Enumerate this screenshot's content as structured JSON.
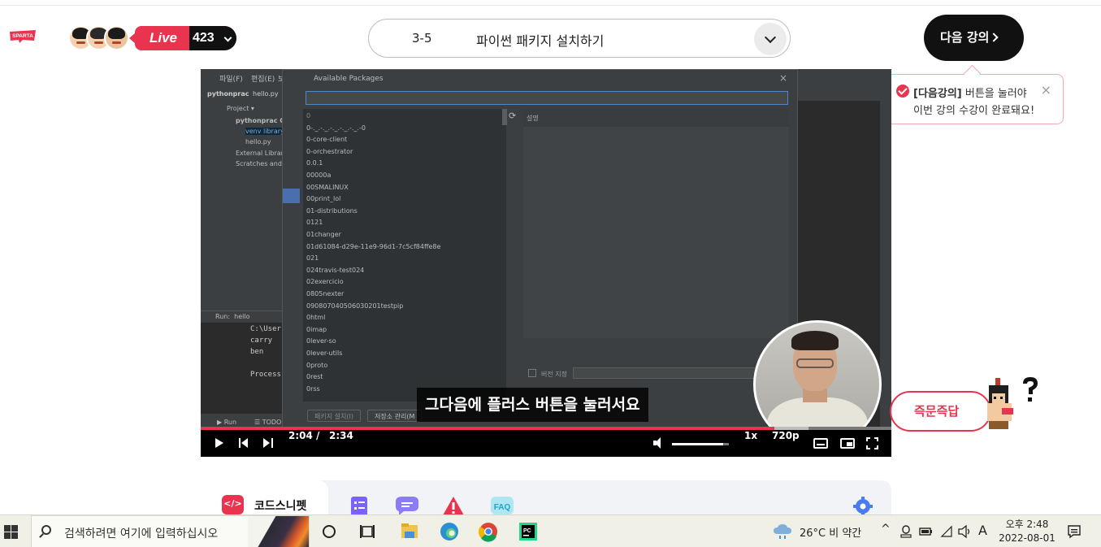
{
  "header": {
    "logo_text": "SPARTA",
    "live_label": "Live",
    "viewer_count": "423",
    "lecture_number": "3-5",
    "lecture_title": "파이썬 패키지 설치하기",
    "next_button_label": "다음 강의",
    "tooltip": {
      "bold_text": "[다음강의]",
      "line1_rest": " 버튼을 눌러야",
      "line2": "이번 강의 수강이 완료돼요!",
      "close": "×"
    }
  },
  "video": {
    "ide": {
      "menu": [
        "파일(F)",
        "편집(E)",
        "보"
      ],
      "project_name": "pythonprac",
      "open_file": "hello.py",
      "tree": [
        "Project ▾",
        "pythonprac C:",
        "venv library",
        "hello.py",
        "External Librarie",
        "Scratches and C"
      ],
      "run_tab": "hello",
      "run_label": "Run:",
      "run_output": [
        "C:\\User",
        "carry",
        "ben",
        "",
        "Process"
      ],
      "bottom_tabs": [
        "▶ Run",
        "☰ TODO"
      ]
    },
    "dialog": {
      "title": "Available Packages",
      "close": "×",
      "packages": [
        "0",
        "0-._.-._.-._.-._.-._.-0",
        "0-core-client",
        "0-orchestrator",
        "0.0.1",
        "00000a",
        "00SMALINUX",
        "00print_lol",
        "01-distributions",
        "0121",
        "01changer",
        "01d61084-d29e-11e9-96d1-7c5cf84ffe8e",
        "021",
        "024travis-test024",
        "02exercicio",
        "0805nexter",
        "090807040506030201testpip",
        "0html",
        "0imap",
        "0lever-so",
        "0lever-utils",
        "0proto",
        "0rest",
        "0rss"
      ],
      "description_header": "설명",
      "version_label": "버전 지정",
      "install_button": "패키지 설치(I)",
      "manage_button": "저장소 관리(M"
    },
    "subtitle": "그다음에 플러스 버튼을 눌러서요",
    "progress_fraction": 0.83,
    "buffered_fraction": 0.88,
    "current_time": "2:04",
    "time_separator": "/",
    "duration": "2:34",
    "volume_fraction": 0.9,
    "speed": "1x",
    "quality": "720p"
  },
  "qna": {
    "label": "즉문즉답"
  },
  "tools": {
    "active_tab_label": "코드스니펫",
    "active_tab_icon": "</>",
    "faq_label": "FAQ"
  },
  "taskbar": {
    "search_placeholder": "검색하려면 여기에 입력하십시오",
    "weather": "26°C  비 약간",
    "ime": "A",
    "time": "오후 2:48",
    "date": "2022-08-01"
  },
  "colors": {
    "accent": "#e8344e",
    "dark": "#111111",
    "ide_bg": "#2b2b2b"
  }
}
